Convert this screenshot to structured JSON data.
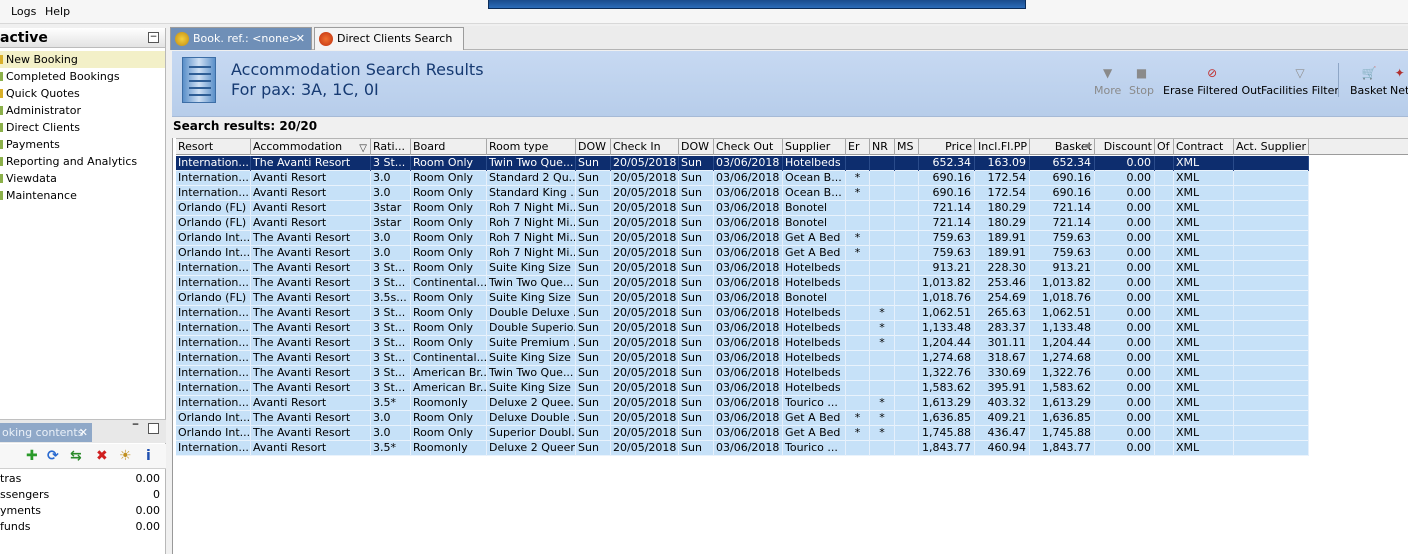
{
  "menu": {
    "logs": "Logs",
    "help": "Help"
  },
  "left": {
    "title": "active",
    "nav": [
      {
        "label": "New Booking",
        "selected": true
      },
      {
        "label": "Completed Bookings"
      },
      {
        "label": "Quick Quotes"
      },
      {
        "label": "Administrator"
      },
      {
        "label": "Direct Clients"
      },
      {
        "label": "Payments"
      },
      {
        "label": "Reporting and Analytics"
      },
      {
        "label": "Viewdata"
      },
      {
        "label": "Maintenance"
      }
    ],
    "booking_tab": "oking contents",
    "booking_rows": [
      {
        "label": "tras",
        "value": "0.00"
      },
      {
        "label": "ssengers",
        "value": "0"
      },
      {
        "label": "yments",
        "value": "0.00"
      },
      {
        "label": "funds",
        "value": "0.00"
      }
    ]
  },
  "tabs": [
    {
      "label": "Book. ref.: <none>",
      "active": true
    },
    {
      "label": "Direct Clients Search",
      "active": false
    }
  ],
  "header": {
    "title": "Accommodation Search Results",
    "subtitle": "For pax: 3A, 1C, 0I"
  },
  "toolbar": {
    "more": "More",
    "stop": "Stop",
    "erase": "Erase Filtered Out",
    "facilities": "Facilities Filter",
    "basket": "Basket",
    "net": "Net"
  },
  "results_label": "Search results: 20/20",
  "columns": [
    "Resort",
    "Accommodation",
    "Rati...",
    "Board",
    "Room type",
    "DOW",
    "Check In",
    "DOW",
    "Check Out",
    "Supplier",
    "Er",
    "NR",
    "MS",
    "Price",
    "Incl.Fl.PP",
    "Basket",
    "Discount",
    "Of",
    "Contract",
    "Act. Supplier"
  ],
  "rows": [
    [
      "Internation...",
      "The Avanti Resort",
      "3 St...",
      "Room Only",
      "Twin Two Que...",
      "Sun",
      "20/05/2018",
      "Sun",
      "03/06/2018",
      "Hotelbeds",
      "",
      "",
      "",
      "652.34",
      "163.09",
      "652.34",
      "0.00",
      "",
      "XML",
      ""
    ],
    [
      "Internation...",
      "Avanti Resort",
      "3.0",
      "Room Only",
      "Standard 2 Qu...",
      "Sun",
      "20/05/2018",
      "Sun",
      "03/06/2018",
      "Ocean B...",
      "*",
      "",
      "",
      "690.16",
      "172.54",
      "690.16",
      "0.00",
      "",
      "XML",
      ""
    ],
    [
      "Internation...",
      "Avanti Resort",
      "3.0",
      "Room Only",
      "Standard King ...",
      "Sun",
      "20/05/2018",
      "Sun",
      "03/06/2018",
      "Ocean B...",
      "*",
      "",
      "",
      "690.16",
      "172.54",
      "690.16",
      "0.00",
      "",
      "XML",
      ""
    ],
    [
      "Orlando (FL)",
      "Avanti Resort",
      "3star",
      "Room Only",
      "Roh 7 Night Mi...",
      "Sun",
      "20/05/2018",
      "Sun",
      "03/06/2018",
      "Bonotel",
      "",
      "",
      "",
      "721.14",
      "180.29",
      "721.14",
      "0.00",
      "",
      "XML",
      ""
    ],
    [
      "Orlando (FL)",
      "Avanti Resort",
      "3star",
      "Room Only",
      "Roh 7 Night Mi...",
      "Sun",
      "20/05/2018",
      "Sun",
      "03/06/2018",
      "Bonotel",
      "",
      "",
      "",
      "721.14",
      "180.29",
      "721.14",
      "0.00",
      "",
      "XML",
      ""
    ],
    [
      "Orlando Int...",
      "The Avanti Resort",
      "3.0",
      "Room Only",
      "Roh 7 Night Mi...",
      "Sun",
      "20/05/2018",
      "Sun",
      "03/06/2018",
      "Get A Bed",
      "*",
      "",
      "",
      "759.63",
      "189.91",
      "759.63",
      "0.00",
      "",
      "XML",
      ""
    ],
    [
      "Orlando Int...",
      "The Avanti Resort",
      "3.0",
      "Room Only",
      "Roh 7 Night Mi...",
      "Sun",
      "20/05/2018",
      "Sun",
      "03/06/2018",
      "Get A Bed",
      "*",
      "",
      "",
      "759.63",
      "189.91",
      "759.63",
      "0.00",
      "",
      "XML",
      ""
    ],
    [
      "Internation...",
      "The Avanti Resort",
      "3 St...",
      "Room Only",
      "Suite King Size ...",
      "Sun",
      "20/05/2018",
      "Sun",
      "03/06/2018",
      "Hotelbeds",
      "",
      "",
      "",
      "913.21",
      "228.30",
      "913.21",
      "0.00",
      "",
      "XML",
      ""
    ],
    [
      "Internation...",
      "The Avanti Resort",
      "3 St...",
      "Continental...",
      "Twin Two Que...",
      "Sun",
      "20/05/2018",
      "Sun",
      "03/06/2018",
      "Hotelbeds",
      "",
      "",
      "",
      "1,013.82",
      "253.46",
      "1,013.82",
      "0.00",
      "",
      "XML",
      ""
    ],
    [
      "Orlando (FL)",
      "The Avanti Resort",
      "3.5s...",
      "Room Only",
      "Suite King Size ...",
      "Sun",
      "20/05/2018",
      "Sun",
      "03/06/2018",
      "Bonotel",
      "",
      "",
      "",
      "1,018.76",
      "254.69",
      "1,018.76",
      "0.00",
      "",
      "XML",
      ""
    ],
    [
      "Internation...",
      "The Avanti Resort",
      "3 St...",
      "Room Only",
      "Double Deluxe ...",
      "Sun",
      "20/05/2018",
      "Sun",
      "03/06/2018",
      "Hotelbeds",
      "",
      "*",
      "",
      "1,062.51",
      "265.63",
      "1,062.51",
      "0.00",
      "",
      "XML",
      ""
    ],
    [
      "Internation...",
      "The Avanti Resort",
      "3 St...",
      "Room Only",
      "Double Superio...",
      "Sun",
      "20/05/2018",
      "Sun",
      "03/06/2018",
      "Hotelbeds",
      "",
      "*",
      "",
      "1,133.48",
      "283.37",
      "1,133.48",
      "0.00",
      "",
      "XML",
      ""
    ],
    [
      "Internation...",
      "The Avanti Resort",
      "3 St...",
      "Room Only",
      "Suite Premium ...",
      "Sun",
      "20/05/2018",
      "Sun",
      "03/06/2018",
      "Hotelbeds",
      "",
      "*",
      "",
      "1,204.44",
      "301.11",
      "1,204.44",
      "0.00",
      "",
      "XML",
      ""
    ],
    [
      "Internation...",
      "The Avanti Resort",
      "3 St...",
      "Continental...",
      "Suite King Size ...",
      "Sun",
      "20/05/2018",
      "Sun",
      "03/06/2018",
      "Hotelbeds",
      "",
      "",
      "",
      "1,274.68",
      "318.67",
      "1,274.68",
      "0.00",
      "",
      "XML",
      ""
    ],
    [
      "Internation...",
      "The Avanti Resort",
      "3 St...",
      "American Br...",
      "Twin Two Que...",
      "Sun",
      "20/05/2018",
      "Sun",
      "03/06/2018",
      "Hotelbeds",
      "",
      "",
      "",
      "1,322.76",
      "330.69",
      "1,322.76",
      "0.00",
      "",
      "XML",
      ""
    ],
    [
      "Internation...",
      "The Avanti Resort",
      "3 St...",
      "American Br...",
      "Suite King Size ...",
      "Sun",
      "20/05/2018",
      "Sun",
      "03/06/2018",
      "Hotelbeds",
      "",
      "",
      "",
      "1,583.62",
      "395.91",
      "1,583.62",
      "0.00",
      "",
      "XML",
      ""
    ],
    [
      "Internation...",
      "Avanti Resort",
      "3.5*",
      "Roomonly",
      "Deluxe 2 Quee...",
      "Sun",
      "20/05/2018",
      "Sun",
      "03/06/2018",
      "Tourico ...",
      "",
      "*",
      "",
      "1,613.29",
      "403.32",
      "1,613.29",
      "0.00",
      "",
      "XML",
      ""
    ],
    [
      "Orlando Int...",
      "The Avanti Resort",
      "3.0",
      "Room Only",
      "Deluxe Double ...",
      "Sun",
      "20/05/2018",
      "Sun",
      "03/06/2018",
      "Get A Bed",
      "*",
      "*",
      "",
      "1,636.85",
      "409.21",
      "1,636.85",
      "0.00",
      "",
      "XML",
      ""
    ],
    [
      "Orlando Int...",
      "The Avanti Resort",
      "3.0",
      "Room Only",
      "Superior Doubl...",
      "Sun",
      "20/05/2018",
      "Sun",
      "03/06/2018",
      "Get A Bed",
      "*",
      "*",
      "",
      "1,745.88",
      "436.47",
      "1,745.88",
      "0.00",
      "",
      "XML",
      ""
    ],
    [
      "Internation...",
      "Avanti Resort",
      "3.5*",
      "Roomonly",
      "Deluxe 2 Queens",
      "Sun",
      "20/05/2018",
      "Sun",
      "03/06/2018",
      "Tourico ...",
      "",
      "",
      "",
      "1,843.77",
      "460.94",
      "1,843.77",
      "0.00",
      "",
      "XML",
      ""
    ]
  ],
  "colors": {
    "row_bg": "#c6e1f8",
    "selected_row_bg": "#0d2d6e",
    "header_bg": "#c7d9f2",
    "tab_active": "#6f8fb7"
  }
}
